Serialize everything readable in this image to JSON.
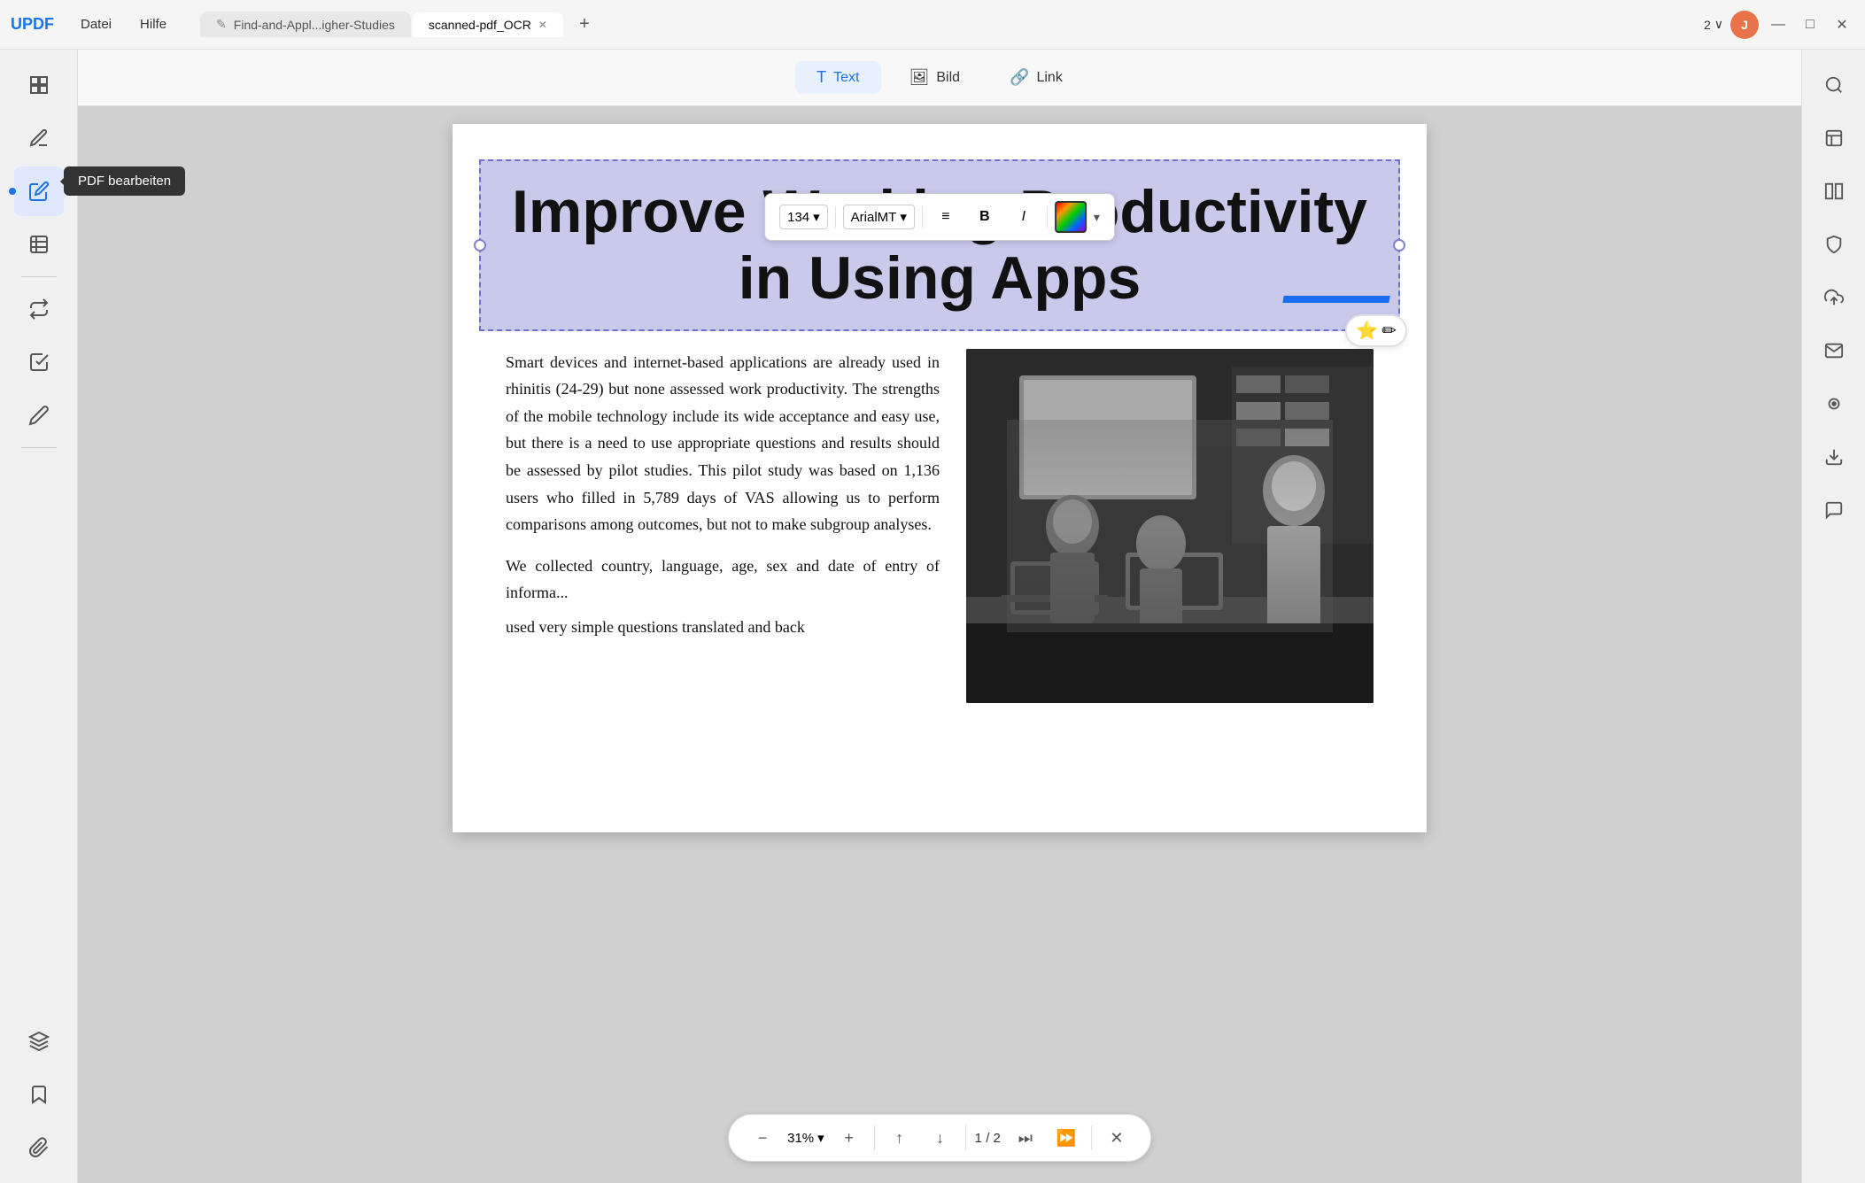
{
  "app": {
    "logo": "UPDF",
    "menus": [
      "Datei",
      "Hilfe"
    ]
  },
  "tabs": [
    {
      "id": "tab1",
      "label": "Find-and-Appl...igher-Studies",
      "active": false,
      "closeable": false
    },
    {
      "id": "tab2",
      "label": "scanned-pdf_OCR",
      "active": true,
      "closeable": true
    }
  ],
  "title_bar": {
    "page_indicator": "2",
    "chevron": "∨",
    "user_initial": "J",
    "minimize": "—",
    "maximize": "□",
    "close": "✕"
  },
  "toolbar": {
    "text_label": "Text",
    "image_label": "Bild",
    "link_label": "Link"
  },
  "format_toolbar": {
    "font_size": "134",
    "font_name": "ArialMT",
    "align_icon": "≡",
    "bold_icon": "B",
    "italic_icon": "I"
  },
  "sidebar_left": {
    "items": [
      {
        "icon": "☰",
        "name": "thumbnail-icon",
        "tooltip": ""
      },
      {
        "icon": "✎",
        "name": "edit-icon",
        "tooltip": ""
      },
      {
        "icon": "✎",
        "name": "edit-pdf-icon",
        "tooltip": "PDF bearbeiten",
        "active": true
      },
      {
        "icon": "⊞",
        "name": "organize-icon",
        "tooltip": ""
      },
      {
        "icon": "⬡",
        "name": "convert-icon",
        "tooltip": ""
      },
      {
        "icon": "✦",
        "name": "comment-icon",
        "tooltip": ""
      },
      {
        "icon": "🔖",
        "name": "bookmark-icon",
        "tooltip": ""
      },
      {
        "icon": "🔗",
        "name": "attachment-icon",
        "tooltip": ""
      }
    ],
    "bottom_items": [
      {
        "icon": "⊕",
        "name": "layers-icon"
      },
      {
        "icon": "🔖",
        "name": "bookmarks-icon"
      },
      {
        "icon": "📎",
        "name": "clip-icon"
      }
    ]
  },
  "sidebar_right": {
    "items": [
      {
        "icon": "🔍",
        "name": "search-right-icon"
      },
      {
        "icon": "⊞",
        "name": "ocr-icon"
      },
      {
        "icon": "↓",
        "name": "download-icon"
      },
      {
        "icon": "↑",
        "name": "upload-icon"
      },
      {
        "icon": "✉",
        "name": "mail-icon"
      },
      {
        "icon": "🔒",
        "name": "protect-icon"
      },
      {
        "icon": "↗",
        "name": "share-icon"
      },
      {
        "icon": "✉",
        "name": "send-icon"
      },
      {
        "icon": "💬",
        "name": "chat-icon"
      }
    ]
  },
  "document": {
    "title": "Improve Working Productivity\nin Using Apps",
    "body_text": "Smart devices and internet-based applications are already used in rhinitis (24-29) but none assessed work productivity. The strengths of the mobile technology include its wide acceptance and easy use, but there is a need to use appropriate questions and results should be assessed by pilot studies. This pilot study was based on 1,136 users who filled in 5,789 days of VAS allowing us to perform comparisons among outcomes, but not to make subgroup analyses.\nWe collected country, language, age, sex and date of entry of informa...\nused very simple questions translated and back"
  },
  "bottom_nav": {
    "zoom_out": "−",
    "zoom_level": "31%",
    "zoom_in": "+",
    "up_arrow": "↑",
    "down_arrow": "↓",
    "page_current": "1",
    "page_separator": "/",
    "page_total": "2",
    "skip_end": "⏭",
    "next_page": "⏩",
    "close": "✕"
  },
  "tooltip": "PDF bearbeiten",
  "ai_badge": {
    "icon1": "⭐",
    "icon2": "✏"
  }
}
